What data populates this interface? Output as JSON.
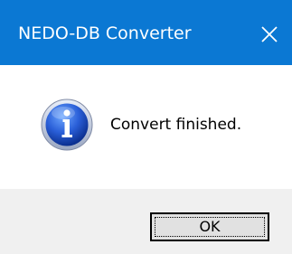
{
  "window": {
    "title": "NEDO-DB Converter",
    "close_icon": "close-icon",
    "titlebar_color": "#0b78d3"
  },
  "dialog": {
    "icon": "info-icon",
    "message": "Convert finished."
  },
  "buttons": {
    "ok_label": "OK"
  }
}
